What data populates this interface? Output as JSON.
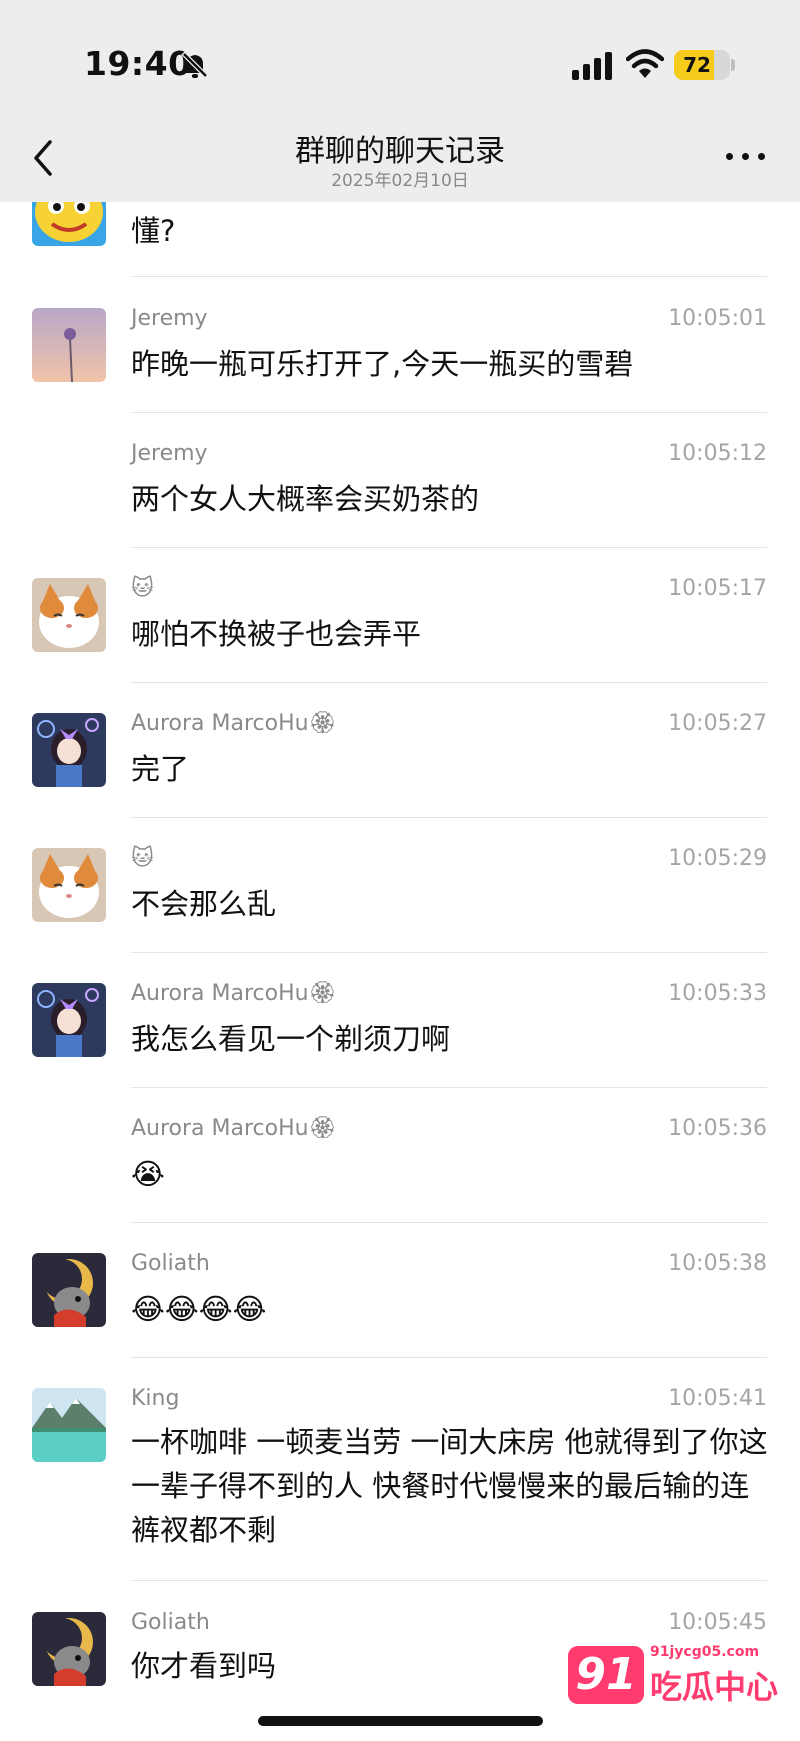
{
  "status_bar": {
    "time": "19:40",
    "battery": "72",
    "battery_level": 0.72
  },
  "nav": {
    "title": "群聊的聊天记录",
    "subtitle": "2025年02月10日"
  },
  "messages": [
    {
      "sender": "",
      "time": "",
      "text": "懂?",
      "avatar": "yellow-cartoon-avatar"
    },
    {
      "sender": "Jeremy",
      "time": "10:05:01",
      "text": "昨晚一瓶可乐打开了,今天一瓶买的雪碧",
      "avatar": "flower-sunset-avatar"
    },
    {
      "sender": "Jeremy",
      "time": "10:05:12",
      "text": "两个女人大概率会买奶茶的",
      "avatar": ""
    },
    {
      "sender": "🐱",
      "time": "10:05:17",
      "text": "哪怕不换被子也会弄平",
      "avatar": "cat-avatar"
    },
    {
      "sender": "Aurora MarcoHu🏵",
      "time": "10:05:27",
      "text": "完了",
      "avatar": "anime-girl-avatar"
    },
    {
      "sender": "🐱",
      "time": "10:05:29",
      "text": "不会那么乱",
      "avatar": "cat-avatar"
    },
    {
      "sender": "Aurora MarcoHu🏵",
      "time": "10:05:33",
      "text": "我怎么看见一个剃须刀啊",
      "avatar": "anime-girl-avatar"
    },
    {
      "sender": "Aurora MarcoHu🏵",
      "time": "10:05:36",
      "text": "😭",
      "avatar": ""
    },
    {
      "sender": "Goliath",
      "time": "10:05:38",
      "text": "😂😂😂😂",
      "avatar": "dog-moon-avatar"
    },
    {
      "sender": "King",
      "time": "10:05:41",
      "text": "一杯咖啡 一顿麦当劳 一间大床房 他就得到了你这一辈子得不到的人 快餐时代慢慢来的最后输的连裤衩都不剩",
      "avatar": "mountain-lake-avatar"
    },
    {
      "sender": "Goliath",
      "time": "10:05:45",
      "text": "你才看到吗",
      "avatar": "dog-moon-avatar"
    }
  ],
  "watermark": {
    "badge": "91",
    "domain": "91jycg05.com",
    "text": "吃瓜中心"
  },
  "icons": [
    "bell-off-icon",
    "signal-icon",
    "wifi-icon",
    "battery-icon",
    "chevron-left-icon",
    "more-icon"
  ]
}
